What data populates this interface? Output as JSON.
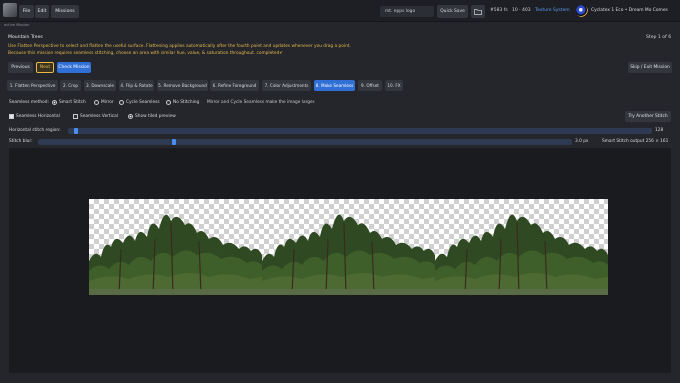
{
  "menubar": {
    "items": [
      {
        "label": "File"
      },
      {
        "label": "Edit"
      },
      {
        "label": "Missions"
      }
    ],
    "mission_field": "mt. epps logo",
    "quick_save": "Quick Save",
    "stats": {
      "count": "#583 fs",
      "quality": "10 · 403"
    },
    "texture_system": "Texture System",
    "pipeline": "Cyclatex 1 Eco  •  Dream Mo Comes"
  },
  "sub_label": "active Mission",
  "mission": {
    "title": "Mountain Trees",
    "step": "Step 1 of 6",
    "instructions": [
      "Use Flatten Perspective to select and flatten the useful surface. Flattening applies automatically after the fourth point and updates whenever you drag a point.",
      "Because this mission requires seamless stitching, choose an area with similar hue, value, & saturation throughout. completed✔"
    ]
  },
  "actions": {
    "previous": "Previous",
    "next": "Next",
    "check": "Check Mission",
    "skip": "Skip / Exit Mission"
  },
  "tabs": [
    {
      "label": "1. Flatten Perspective"
    },
    {
      "label": "2. Crop"
    },
    {
      "label": "3. Downscale"
    },
    {
      "label": "4. Flip & Rotate"
    },
    {
      "label": "5. Remove Background"
    },
    {
      "label": "6. Refine Foreground"
    },
    {
      "label": "7. Color Adjustments"
    },
    {
      "label": "8. Make Seamless"
    },
    {
      "label": "9. Offset"
    },
    {
      "label": "10. FX"
    }
  ],
  "seamless": {
    "method_label": "Seamless method:",
    "methods": [
      {
        "label": "Smart Stitch",
        "selected": true
      },
      {
        "label": "Mirror",
        "selected": false
      },
      {
        "label": "Cycle Seamless",
        "selected": false
      },
      {
        "label": "No Stitching",
        "selected": false
      }
    ],
    "hint": "Mirror and Cycle Seamless make the image larger.",
    "horizontal": {
      "label": "Seamless Horizontal",
      "checked": true
    },
    "vertical": {
      "label": "Seamless Vertical",
      "checked": false
    },
    "preview": {
      "label": "Show tiled preview",
      "checked": true
    },
    "try_another": "Try Another Stitch",
    "region_label": "Horizontal stitch region:",
    "region_value": "128",
    "region_level": 0.01,
    "blur_label": "Stitch blur:",
    "blur_value": "3.0 px",
    "blur_level": 0.25,
    "output": "Smart Stitch output 256 × 161"
  },
  "colors": {
    "accent": "#2f6fd6",
    "highlight": "#e5b94a",
    "texture_system": "#5a9cf0"
  },
  "icons": [
    "app-logo-icon",
    "folder-icon",
    "disc-icon"
  ]
}
